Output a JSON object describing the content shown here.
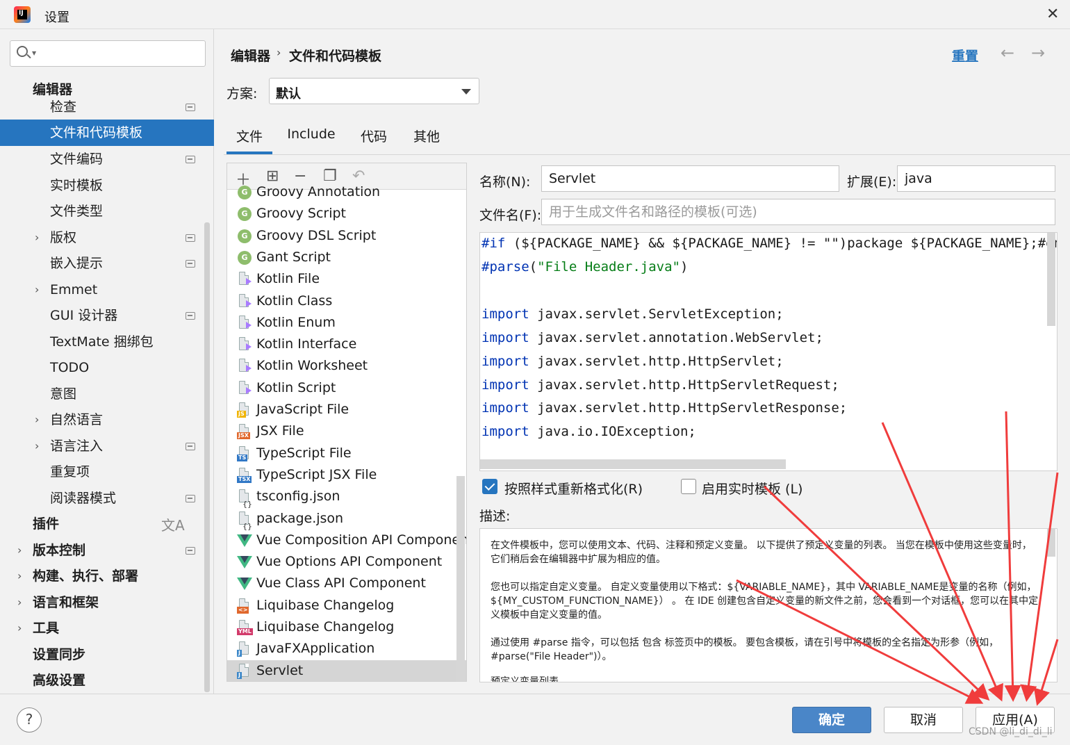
{
  "window": {
    "title": "设置"
  },
  "search": {
    "placeholder": ""
  },
  "sidebar": {
    "items": [
      {
        "label": "编辑器"
      },
      {
        "label": "检查"
      },
      {
        "label": "文件和代码模板"
      },
      {
        "label": "文件编码"
      },
      {
        "label": "实时模板"
      },
      {
        "label": "文件类型"
      },
      {
        "label": "版权"
      },
      {
        "label": "嵌入提示"
      },
      {
        "label": "Emmet"
      },
      {
        "label": "GUI 设计器"
      },
      {
        "label": "TextMate 捆绑包"
      },
      {
        "label": "TODO"
      },
      {
        "label": "意图"
      },
      {
        "label": "自然语言"
      },
      {
        "label": "语言注入"
      },
      {
        "label": "重复项"
      },
      {
        "label": "阅读器模式"
      },
      {
        "label": "插件"
      },
      {
        "label": "版本控制"
      },
      {
        "label": "构建、执行、部署"
      },
      {
        "label": "语言和框架"
      },
      {
        "label": "工具"
      },
      {
        "label": "设置同步"
      },
      {
        "label": "高级设置"
      }
    ]
  },
  "header": {
    "crumb_parent": "编辑器",
    "crumb_current": "文件和代码模板",
    "reset_label": "重置"
  },
  "scheme": {
    "label": "方案:",
    "value": "默认"
  },
  "tabs": [
    {
      "label": "文件"
    },
    {
      "label": "Include"
    },
    {
      "label": "代码"
    },
    {
      "label": "其他"
    }
  ],
  "templates": [
    {
      "label": "Groovy Annotation",
      "icon": "groovy-icon"
    },
    {
      "label": "Groovy Script",
      "icon": "groovy-icon"
    },
    {
      "label": "Groovy DSL Script",
      "icon": "groovy-icon"
    },
    {
      "label": "Gant Script",
      "icon": "groovy-icon"
    },
    {
      "label": "Kotlin File",
      "icon": "kotlin-file-icon"
    },
    {
      "label": "Kotlin Class",
      "icon": "kotlin-file-icon"
    },
    {
      "label": "Kotlin Enum",
      "icon": "kotlin-file-icon"
    },
    {
      "label": "Kotlin Interface",
      "icon": "kotlin-file-icon"
    },
    {
      "label": "Kotlin Worksheet",
      "icon": "kotlin-file-icon"
    },
    {
      "label": "Kotlin Script",
      "icon": "kotlin-file-icon"
    },
    {
      "label": "JavaScript File",
      "icon": "js-file-icon",
      "badge": "JS"
    },
    {
      "label": "JSX File",
      "icon": "jsx-file-icon",
      "badge": "JSX"
    },
    {
      "label": "TypeScript File",
      "icon": "ts-file-icon",
      "badge": "TS"
    },
    {
      "label": "TypeScript JSX File",
      "icon": "tsx-file-icon",
      "badge": "TSX"
    },
    {
      "label": "tsconfig.json",
      "icon": "json-file-icon",
      "badge": "{}"
    },
    {
      "label": "package.json",
      "icon": "json-file-icon",
      "badge": "{}"
    },
    {
      "label": "Vue Composition API Component",
      "icon": "vue-icon"
    },
    {
      "label": "Vue Options API Component",
      "icon": "vue-icon"
    },
    {
      "label": "Vue Class API Component",
      "icon": "vue-icon"
    },
    {
      "label": "Liquibase Changelog",
      "icon": "xml-file-icon",
      "badge": "<>"
    },
    {
      "label": "Liquibase Changelog",
      "icon": "yml-file-icon",
      "badge": "YML"
    },
    {
      "label": "JavaFXApplication",
      "icon": "java-file-icon",
      "badge": "J"
    },
    {
      "label": "Servlet",
      "icon": "java-file-icon",
      "badge": "J"
    }
  ],
  "form": {
    "name_label": "名称(N):",
    "name_value": "Servlet",
    "ext_label": "扩展(E):",
    "ext_value": "java",
    "filename_label": "文件名(F):",
    "filename_placeholder": "用于生成文件名和路径的模板(可选)",
    "reformat_label": "按照样式重新格式化(R)",
    "reformat_checked": true,
    "live_label": "启用实时模板 (L)",
    "live_checked": false,
    "desc_label": "描述:"
  },
  "code": {
    "l1_kw": "#if",
    "l1_rest": " (${PACKAGE_NAME} && ${PACKAGE_NAME} != \"\")package ${PACKAGE_NAME};#end",
    "l2_kw": "#parse",
    "l2_open": "(",
    "l2_str": "\"File Header.java\"",
    "l2_close": ")",
    "import_kw": "import",
    "imports": [
      " javax.servlet.ServletException;",
      " javax.servlet.annotation.WebServlet;",
      " javax.servlet.http.HttpServlet;",
      " javax.servlet.http.HttpServletRequest;",
      " javax.servlet.http.HttpServletResponse;",
      " java.io.IOException;"
    ]
  },
  "description": {
    "p1": "在文件模板中，您可以使用文本、代码、注释和预定义变量。 以下提供了预定义变量的列表。 当您在模板中使用这些变量时，它们稍后会在编辑器中扩展为相应的值。",
    "p2": "您也可以指定自定义变量。 自定义变量使用以下格式：${VARIABLE_NAME}，其中 VARIABLE_NAME是变量的名称（例如，${MY_CUSTOM_FUNCTION_NAME}） 。 在 IDE 创建包含自定义变量的新文件之前，您会看到一个对话框，您可以在其中定义模板中自定义变量的值。",
    "p3": "通过使用 #parse 指令，可以包括 包含 标签页中的模板。 要包含模板，请在引号中将模板的全名指定为形参（例如，#parse(\"File Header\")）。",
    "p4": "预定义变量列表"
  },
  "footer": {
    "help": "?",
    "ok_label": "确定",
    "cancel_label": "取消",
    "apply_label": "应用(A)",
    "watermark": "CSDN @li_di_di_li"
  },
  "colors": {
    "accent": "#2675bf",
    "annotation_arrow": "#f03c3c"
  }
}
